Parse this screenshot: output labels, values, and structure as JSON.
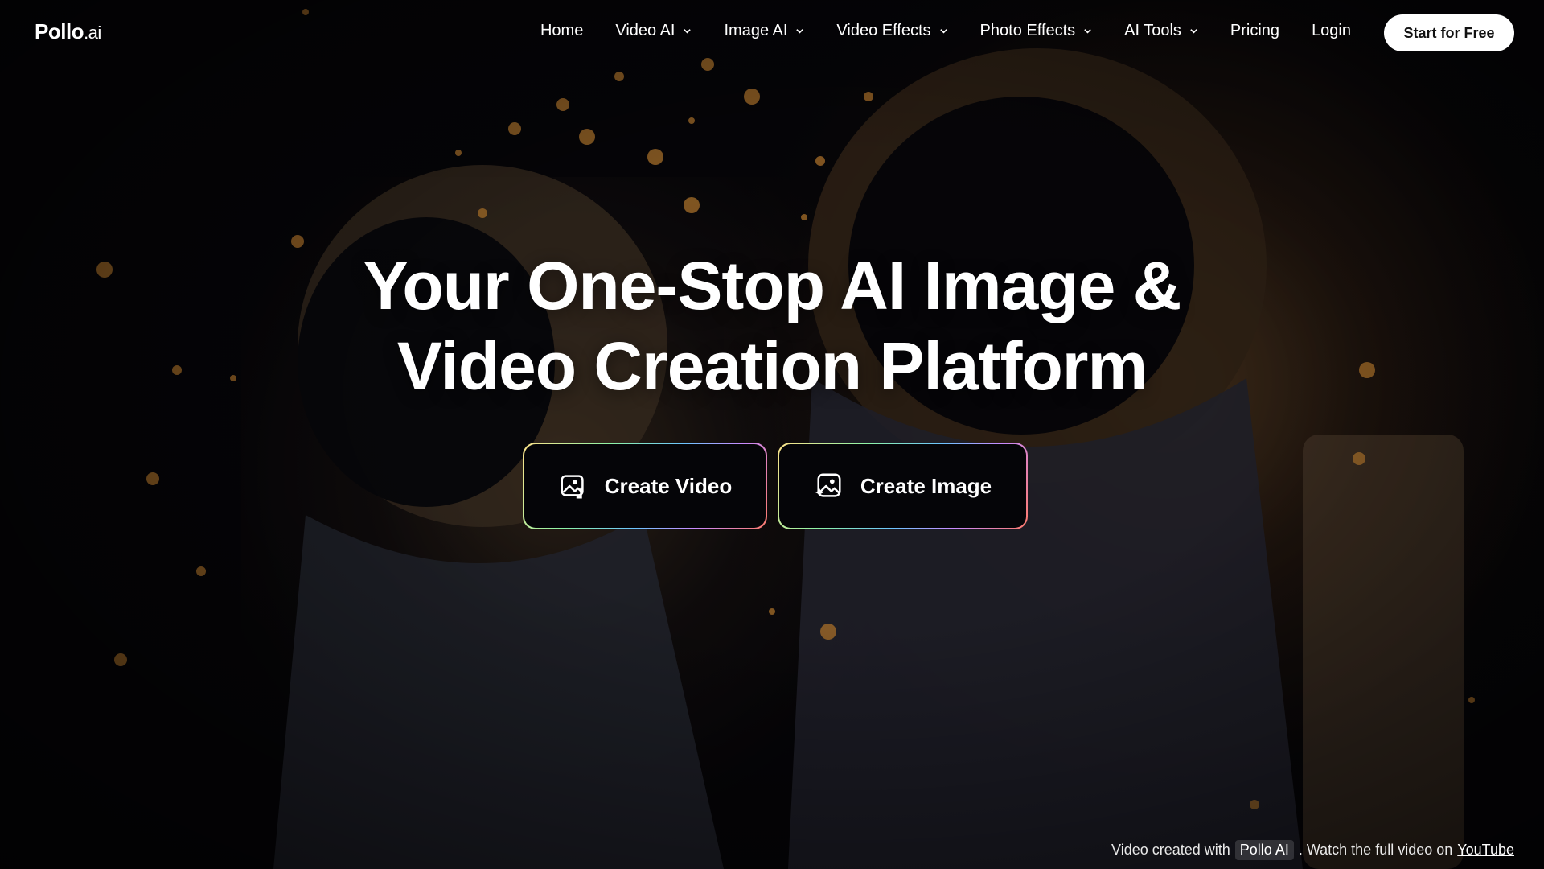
{
  "brand": {
    "name": "Pollo",
    "suffix": ".ai"
  },
  "nav": {
    "items": [
      {
        "label": "Home",
        "dropdown": false
      },
      {
        "label": "Video AI",
        "dropdown": true
      },
      {
        "label": "Image AI",
        "dropdown": true
      },
      {
        "label": "Video Effects",
        "dropdown": true
      },
      {
        "label": "Photo Effects",
        "dropdown": true
      },
      {
        "label": "AI Tools",
        "dropdown": true
      },
      {
        "label": "Pricing",
        "dropdown": false
      },
      {
        "label": "Login",
        "dropdown": false
      }
    ],
    "cta_label": "Start for Free"
  },
  "hero": {
    "title_line1": "Your One-Stop AI Image &",
    "title_line2": "Video Creation Platform",
    "create_video_label": "Create Video",
    "create_image_label": "Create Image",
    "icons": [
      "video-gallery-icon",
      "image-sparkle-icon"
    ]
  },
  "credit": {
    "prefix": "Video created with",
    "tool": "Pollo AI",
    "middle": ". Watch the full video on",
    "link": "YouTube"
  },
  "colors": {
    "background": "#07060a",
    "cta_bg": "#ffffff",
    "cta_text": "#111111",
    "button_bg": "#050508",
    "ember": "#e89a3a"
  }
}
